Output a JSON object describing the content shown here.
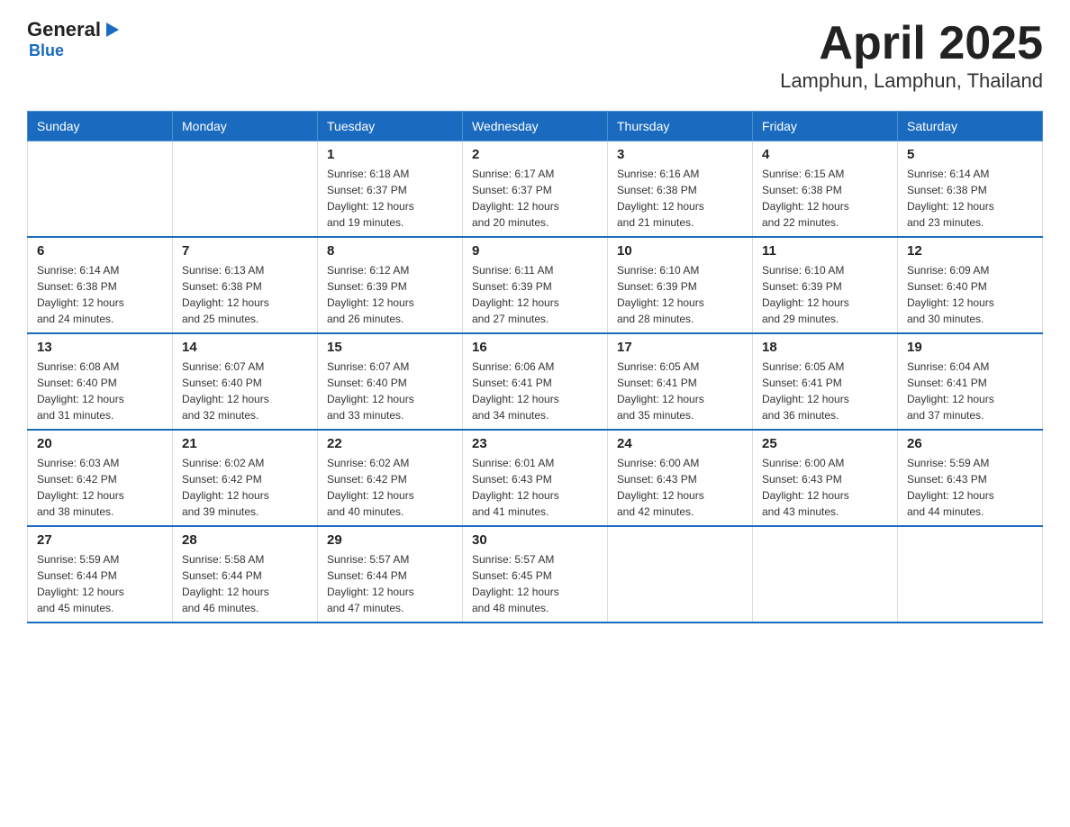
{
  "logo": {
    "text_general": "General",
    "text_blue": "Blue",
    "arrow": "▶"
  },
  "title": "April 2025",
  "subtitle": "Lamphun, Lamphun, Thailand",
  "days_header": [
    "Sunday",
    "Monday",
    "Tuesday",
    "Wednesday",
    "Thursday",
    "Friday",
    "Saturday"
  ],
  "weeks": [
    [
      {
        "day": "",
        "info": ""
      },
      {
        "day": "",
        "info": ""
      },
      {
        "day": "1",
        "info": "Sunrise: 6:18 AM\nSunset: 6:37 PM\nDaylight: 12 hours\nand 19 minutes."
      },
      {
        "day": "2",
        "info": "Sunrise: 6:17 AM\nSunset: 6:37 PM\nDaylight: 12 hours\nand 20 minutes."
      },
      {
        "day": "3",
        "info": "Sunrise: 6:16 AM\nSunset: 6:38 PM\nDaylight: 12 hours\nand 21 minutes."
      },
      {
        "day": "4",
        "info": "Sunrise: 6:15 AM\nSunset: 6:38 PM\nDaylight: 12 hours\nand 22 minutes."
      },
      {
        "day": "5",
        "info": "Sunrise: 6:14 AM\nSunset: 6:38 PM\nDaylight: 12 hours\nand 23 minutes."
      }
    ],
    [
      {
        "day": "6",
        "info": "Sunrise: 6:14 AM\nSunset: 6:38 PM\nDaylight: 12 hours\nand 24 minutes."
      },
      {
        "day": "7",
        "info": "Sunrise: 6:13 AM\nSunset: 6:38 PM\nDaylight: 12 hours\nand 25 minutes."
      },
      {
        "day": "8",
        "info": "Sunrise: 6:12 AM\nSunset: 6:39 PM\nDaylight: 12 hours\nand 26 minutes."
      },
      {
        "day": "9",
        "info": "Sunrise: 6:11 AM\nSunset: 6:39 PM\nDaylight: 12 hours\nand 27 minutes."
      },
      {
        "day": "10",
        "info": "Sunrise: 6:10 AM\nSunset: 6:39 PM\nDaylight: 12 hours\nand 28 minutes."
      },
      {
        "day": "11",
        "info": "Sunrise: 6:10 AM\nSunset: 6:39 PM\nDaylight: 12 hours\nand 29 minutes."
      },
      {
        "day": "12",
        "info": "Sunrise: 6:09 AM\nSunset: 6:40 PM\nDaylight: 12 hours\nand 30 minutes."
      }
    ],
    [
      {
        "day": "13",
        "info": "Sunrise: 6:08 AM\nSunset: 6:40 PM\nDaylight: 12 hours\nand 31 minutes."
      },
      {
        "day": "14",
        "info": "Sunrise: 6:07 AM\nSunset: 6:40 PM\nDaylight: 12 hours\nand 32 minutes."
      },
      {
        "day": "15",
        "info": "Sunrise: 6:07 AM\nSunset: 6:40 PM\nDaylight: 12 hours\nand 33 minutes."
      },
      {
        "day": "16",
        "info": "Sunrise: 6:06 AM\nSunset: 6:41 PM\nDaylight: 12 hours\nand 34 minutes."
      },
      {
        "day": "17",
        "info": "Sunrise: 6:05 AM\nSunset: 6:41 PM\nDaylight: 12 hours\nand 35 minutes."
      },
      {
        "day": "18",
        "info": "Sunrise: 6:05 AM\nSunset: 6:41 PM\nDaylight: 12 hours\nand 36 minutes."
      },
      {
        "day": "19",
        "info": "Sunrise: 6:04 AM\nSunset: 6:41 PM\nDaylight: 12 hours\nand 37 minutes."
      }
    ],
    [
      {
        "day": "20",
        "info": "Sunrise: 6:03 AM\nSunset: 6:42 PM\nDaylight: 12 hours\nand 38 minutes."
      },
      {
        "day": "21",
        "info": "Sunrise: 6:02 AM\nSunset: 6:42 PM\nDaylight: 12 hours\nand 39 minutes."
      },
      {
        "day": "22",
        "info": "Sunrise: 6:02 AM\nSunset: 6:42 PM\nDaylight: 12 hours\nand 40 minutes."
      },
      {
        "day": "23",
        "info": "Sunrise: 6:01 AM\nSunset: 6:43 PM\nDaylight: 12 hours\nand 41 minutes."
      },
      {
        "day": "24",
        "info": "Sunrise: 6:00 AM\nSunset: 6:43 PM\nDaylight: 12 hours\nand 42 minutes."
      },
      {
        "day": "25",
        "info": "Sunrise: 6:00 AM\nSunset: 6:43 PM\nDaylight: 12 hours\nand 43 minutes."
      },
      {
        "day": "26",
        "info": "Sunrise: 5:59 AM\nSunset: 6:43 PM\nDaylight: 12 hours\nand 44 minutes."
      }
    ],
    [
      {
        "day": "27",
        "info": "Sunrise: 5:59 AM\nSunset: 6:44 PM\nDaylight: 12 hours\nand 45 minutes."
      },
      {
        "day": "28",
        "info": "Sunrise: 5:58 AM\nSunset: 6:44 PM\nDaylight: 12 hours\nand 46 minutes."
      },
      {
        "day": "29",
        "info": "Sunrise: 5:57 AM\nSunset: 6:44 PM\nDaylight: 12 hours\nand 47 minutes."
      },
      {
        "day": "30",
        "info": "Sunrise: 5:57 AM\nSunset: 6:45 PM\nDaylight: 12 hours\nand 48 minutes."
      },
      {
        "day": "",
        "info": ""
      },
      {
        "day": "",
        "info": ""
      },
      {
        "day": "",
        "info": ""
      }
    ]
  ]
}
